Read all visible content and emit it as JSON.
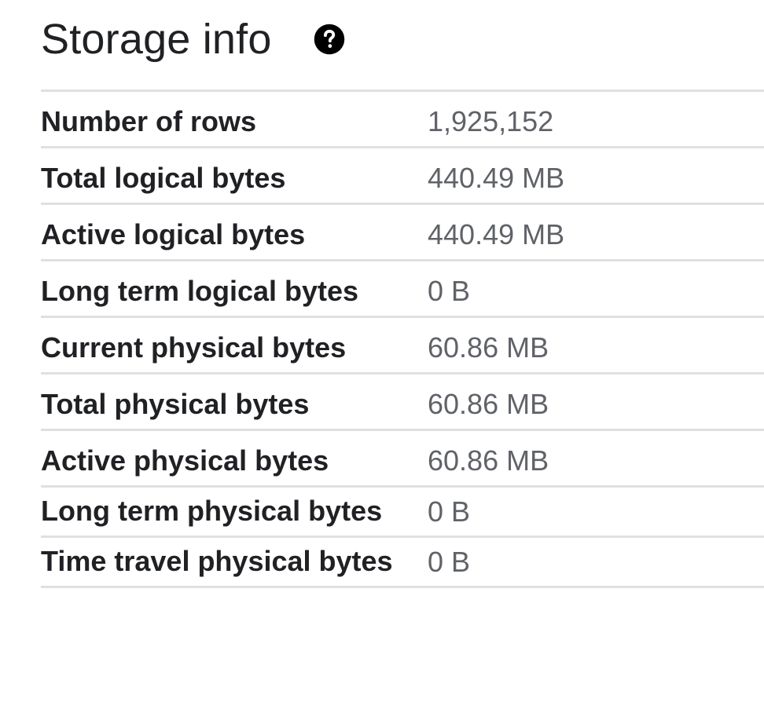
{
  "header": {
    "title": "Storage info",
    "help_icon": "help-circle-icon"
  },
  "rows": [
    {
      "label": "Number of rows",
      "value": "1,925,152"
    },
    {
      "label": "Total logical bytes",
      "value": "440.49 MB"
    },
    {
      "label": "Active logical bytes",
      "value": "440.49 MB"
    },
    {
      "label": "Long term logical bytes",
      "value": "0 B"
    },
    {
      "label": "Current physical bytes",
      "value": "60.86 MB"
    },
    {
      "label": "Total physical bytes",
      "value": "60.86 MB"
    },
    {
      "label": "Active physical bytes",
      "value": "60.86 MB"
    },
    {
      "label": "Long term physical bytes",
      "value": "0 B"
    },
    {
      "label": "Time travel physical bytes",
      "value": "0 B"
    }
  ]
}
